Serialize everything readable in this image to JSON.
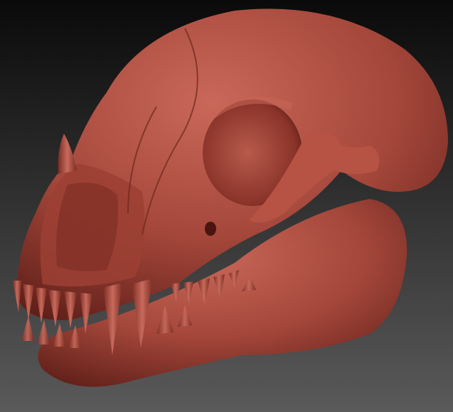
{
  "scene": {
    "subject": "skull-sculpt",
    "colors": {
      "background_top": "#0a0a0a",
      "background_bottom": "#5a5a5a",
      "material_base": "#a4463a",
      "material_light": "#c9685a",
      "material_dark": "#5e1f18",
      "tooth": "#b5574a"
    }
  }
}
